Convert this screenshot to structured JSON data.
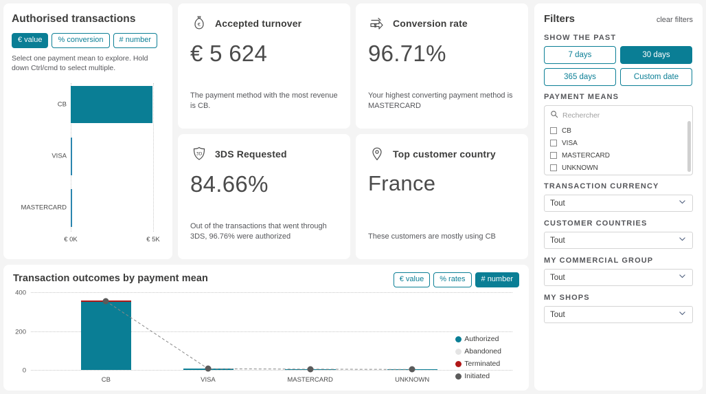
{
  "authorised": {
    "title": "Authorised transactions",
    "toggles": [
      {
        "label": "€ value",
        "active": true
      },
      {
        "label": "% conversion",
        "active": false
      },
      {
        "label": "# number",
        "active": false
      }
    ],
    "hint": "Select one payment mean to explore. Hold down Ctrl/cmd to select multiple."
  },
  "kpis": [
    {
      "icon": "money-bag-icon",
      "title": "Accepted turnover",
      "value": "€ 5 624",
      "sub": "The payment method with the most revenue is CB."
    },
    {
      "icon": "conversion-arrow-icon",
      "title": "Conversion rate",
      "value": "96.71%",
      "sub": "Your highest converting payment method is MASTERCARD"
    },
    {
      "icon": "shield-3ds-icon",
      "title": "3DS Requested",
      "value": "84.66%",
      "sub": "Out of the transactions that went through 3DS, 96.76% were authorized"
    },
    {
      "icon": "map-pin-icon",
      "title": "Top customer country",
      "value": "France",
      "sub": "These customers are mostly using CB"
    }
  ],
  "outcomes": {
    "title": "Transaction outcomes by payment mean",
    "toggles": [
      {
        "label": "€ value",
        "active": false
      },
      {
        "label": "% rates",
        "active": false
      },
      {
        "label": "# number",
        "active": true
      }
    ],
    "legend": [
      {
        "label": "Authorized",
        "color": "#0a7e95"
      },
      {
        "label": "Abandoned",
        "color": "#e4e4e4"
      },
      {
        "label": "Terminated",
        "color": "#b01818"
      },
      {
        "label": "Initiated",
        "color": "#5b5b5b"
      }
    ]
  },
  "filters": {
    "title": "Filters",
    "clear": "clear filters",
    "show_the_past_label": "SHOW THE PAST",
    "day_buttons": [
      {
        "label": "7 days",
        "active": false
      },
      {
        "label": "30 days",
        "active": true
      },
      {
        "label": "365 days",
        "active": false
      },
      {
        "label": "Custom date",
        "active": false
      }
    ],
    "payment_means_label": "PAYMENT MEANS",
    "payment_means_search_placeholder": "Rechercher",
    "payment_means_search_value": "",
    "payment_means_options": [
      {
        "label": "CB",
        "checked": false
      },
      {
        "label": "VISA",
        "checked": false
      },
      {
        "label": "MASTERCARD",
        "checked": false
      },
      {
        "label": "UNKNOWN",
        "checked": false
      }
    ],
    "selects": [
      {
        "label": "TRANSACTION CURRENCY",
        "value": "Tout"
      },
      {
        "label": "CUSTOMER COUNTRIES",
        "value": "Tout"
      },
      {
        "label": "MY COMMERCIAL GROUP",
        "value": "Tout"
      },
      {
        "label": "MY SHOPS",
        "value": "Tout"
      }
    ]
  },
  "chart_data": [
    {
      "type": "bar",
      "orientation": "horizontal",
      "title": "Authorised transactions",
      "categories": [
        "CB",
        "VISA",
        "MASTERCARD"
      ],
      "values": [
        5600,
        14,
        10
      ],
      "xlabel": "",
      "ylabel": "",
      "xlim": [
        0,
        5500
      ],
      "xticks": [
        0,
        5000
      ],
      "xticklabels": [
        "€ 0K",
        "€ 5K"
      ],
      "grid": true,
      "series_color": "#0a7e95"
    },
    {
      "type": "bar",
      "orientation": "vertical",
      "title": "Transaction outcomes by payment mean",
      "categories": [
        "CB",
        "VISA",
        "MASTERCARD",
        "UNKNOWN"
      ],
      "series": [
        {
          "name": "Authorized",
          "color": "#0a7e95",
          "values": [
            352,
            6,
            4,
            1
          ]
        },
        {
          "name": "Abandoned",
          "color": "#e4e4e4",
          "values": [
            0,
            0,
            0,
            0
          ]
        },
        {
          "name": "Terminated",
          "color": "#b01818",
          "values": [
            358,
            6,
            4,
            1
          ]
        },
        {
          "name": "Initiated",
          "color": "#5b5b5b",
          "values": [
            360,
            7,
            5,
            2
          ]
        }
      ],
      "ylim": [
        0,
        430
      ],
      "yticks": [
        0,
        200,
        400
      ],
      "yticklabels": [
        "0",
        "200",
        "400"
      ],
      "grid": true,
      "legend_position": "right"
    }
  ]
}
